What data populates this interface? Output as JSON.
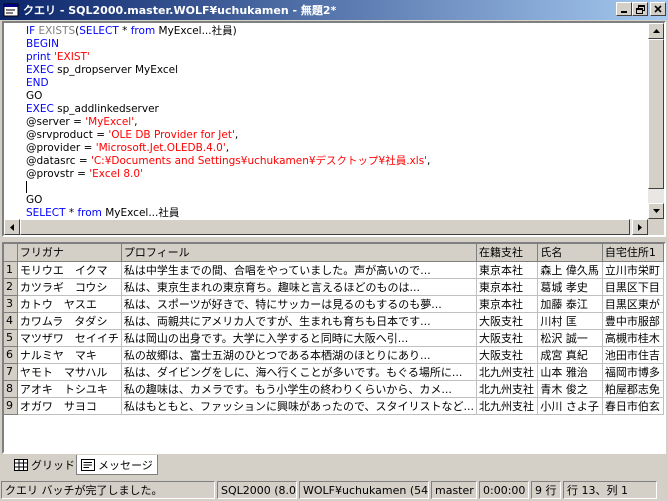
{
  "window": {
    "title": "クエリ - SQL2000.master.WOLF¥uchukamen - 無題2*"
  },
  "editor": {
    "lines": [
      [
        {
          "t": "kw",
          "v": "IF "
        },
        {
          "t": "gray",
          "v": "EXISTS"
        },
        {
          "t": "plain",
          "v": "("
        },
        {
          "t": "kw",
          "v": "SELECT"
        },
        {
          "t": "plain",
          "v": " * "
        },
        {
          "t": "kw",
          "v": "from"
        },
        {
          "t": "plain",
          "v": " MyExcel...社員)"
        }
      ],
      [
        {
          "t": "kw",
          "v": "BEGIN"
        }
      ],
      [
        {
          "t": "kw",
          "v": "print "
        },
        {
          "t": "str",
          "v": "'EXIST'"
        }
      ],
      [
        {
          "t": "kw",
          "v": "EXEC "
        },
        {
          "t": "plain",
          "v": "sp_dropserver MyExcel"
        }
      ],
      [
        {
          "t": "kw",
          "v": "END"
        }
      ],
      [
        {
          "t": "plain",
          "v": "GO"
        }
      ],
      [
        {
          "t": "kw",
          "v": "EXEC "
        },
        {
          "t": "plain",
          "v": "sp_addlinkedserver"
        }
      ],
      [
        {
          "t": "plain",
          "v": "@server = "
        },
        {
          "t": "str",
          "v": "'MyExcel'"
        },
        {
          "t": "plain",
          "v": ","
        }
      ],
      [
        {
          "t": "plain",
          "v": "@srvproduct = "
        },
        {
          "t": "str",
          "v": "'OLE DB Provider for Jet'"
        },
        {
          "t": "plain",
          "v": ","
        }
      ],
      [
        {
          "t": "plain",
          "v": "@provider = "
        },
        {
          "t": "str",
          "v": "'Microsoft.Jet.OLEDB.4.0'"
        },
        {
          "t": "plain",
          "v": ","
        }
      ],
      [
        {
          "t": "plain",
          "v": "@datasrc = "
        },
        {
          "t": "str",
          "v": "'C:¥Documents and Settings¥uchukamen¥デスクトップ¥社員.xls'"
        },
        {
          "t": "plain",
          "v": ","
        }
      ],
      [
        {
          "t": "plain",
          "v": "@provstr = "
        },
        {
          "t": "str",
          "v": "'Excel 8.0'"
        }
      ],
      [
        {
          "t": "caret",
          "v": ""
        }
      ],
      [
        {
          "t": "plain",
          "v": "GO"
        }
      ],
      [
        {
          "t": "kw",
          "v": "SELECT"
        },
        {
          "t": "plain",
          "v": " * "
        },
        {
          "t": "kw",
          "v": "from"
        },
        {
          "t": "plain",
          "v": " MyExcel...社員"
        }
      ]
    ]
  },
  "grid": {
    "columns": [
      "",
      "フリガナ",
      "プロフィール",
      "在籍支社",
      "氏名",
      "自宅住所1"
    ],
    "rows": [
      [
        "1",
        "モリウエ　イクマ",
        "私は中学生までの間、合唱をやっていました。声が高いので...",
        "東京本社",
        "森上 偉久馬",
        "立川市栄町"
      ],
      [
        "2",
        "カツラギ　コウシ",
        "私は、東京生まれの東京育ち。趣味と言えるほどのものは...",
        "東京本社",
        "葛城 孝史",
        "目黒区下目"
      ],
      [
        "3",
        "カトウ　ヤスエ",
        "私は、スポーツが好きで、特にサッカーは見るのもするのも夢...",
        "東京本社",
        "加藤 泰江",
        "目黒区東が"
      ],
      [
        "4",
        "カワムラ　タダシ",
        "私は、両親共にアメリカ人ですが、生まれも育ちも日本です...",
        "大阪支社",
        "川村 匡",
        "豊中市服部"
      ],
      [
        "5",
        "マツザワ　セイイチ",
        "私は岡山の出身です。大学に入学すると同時に大阪へ引...",
        "大阪支社",
        "松沢 誠一",
        "高槻市桂木"
      ],
      [
        "6",
        "ナルミヤ　マキ",
        "私の故郷は、富士五湖のひとつである本栖湖のほとりにあり...",
        "大阪支社",
        "成宮 真紀",
        "池田市住吉"
      ],
      [
        "7",
        "ヤモト　マサハル",
        "私は、ダイビングをしに、海へ行くことが多いです。もぐる場所に...",
        "北九州支社",
        "山本 雅治",
        "福岡市博多"
      ],
      [
        "8",
        "アオキ　トシユキ",
        "私の趣味は、カメラです。もう小学生の終わりくらいから、カメ...",
        "北九州支社",
        "青木 俊之",
        "粕屋郡志免"
      ],
      [
        "9",
        "オガワ　サヨコ",
        "私はもともと、ファッションに興味があったので、スタイリストなど...",
        "北九州支社",
        "小川 さよ子",
        "春日市伯玄"
      ]
    ]
  },
  "tabs": [
    {
      "label": "グリッド"
    },
    {
      "label": "メッセージ"
    }
  ],
  "status": {
    "message": "クエリ バッチが完了しました。",
    "server": "SQL2000 (8.0)",
    "user": "WOLF¥uchukamen (54)",
    "database": "master",
    "elapsed": "0:00:00",
    "rowcount": "9 行",
    "position": "行 13、列 1"
  }
}
